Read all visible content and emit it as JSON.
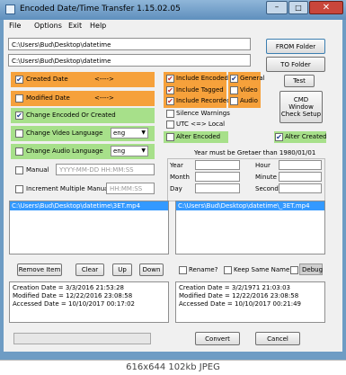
{
  "window": {
    "title": "Encoded Date/Time Transfer 1.15.02.05",
    "minimize": "–",
    "maximize": "□",
    "close": "✕"
  },
  "menu": [
    "File",
    "Options",
    "Exit",
    "Help"
  ],
  "paths": {
    "source": "C:\\Users\\Bud\\Desktop\\datetime",
    "target": "C:\\Users\\Bud\\Desktop\\datetime"
  },
  "buttons": {
    "from_folder": "FROM Folder",
    "to_folder": "TO Folder",
    "test": "Test",
    "cmd_window": "CMD\nWindow\nCheck Setup",
    "remove_item": "Remove Item",
    "clear": "Clear",
    "up": "Up",
    "down": "Down",
    "convert": "Convert",
    "cancel": "Cancel"
  },
  "left_options": {
    "created_date": {
      "label": "Created Date",
      "arrow": "<---->",
      "checked": true
    },
    "modified_date": {
      "label": "Modified Date",
      "arrow": "<---->",
      "checked": false
    },
    "change_encoded": {
      "label": "Change Encoded Or Created",
      "checked": true
    },
    "change_video_lang": {
      "label": "Change Video Language",
      "value": "eng",
      "checked": false
    },
    "change_audio_lang": {
      "label": "Change Audio Language",
      "value": "eng",
      "checked": false
    },
    "manual": {
      "label": "Manual",
      "placeholder": "YYYY-MM-DD HH:MM:SS",
      "checked": false
    },
    "increment": {
      "label": "Increment Multiple Manual",
      "placeholder": "HH:MM:SS",
      "checked": false
    }
  },
  "right_options": {
    "include_encoded": {
      "label": "Include Encoded",
      "checked": true
    },
    "include_tagged": {
      "label": "Include Tagged",
      "checked": true
    },
    "include_recorded": {
      "label": "Include Recorded",
      "checked": true
    },
    "general": {
      "label": "General",
      "checked": true
    },
    "video": {
      "label": "Video",
      "checked": false
    },
    "audio": {
      "label": "Audio",
      "checked": false
    },
    "silence_warnings": {
      "label": "Silence Warnings",
      "checked": false
    },
    "utc_local": {
      "label": "UTC  <=> Local",
      "checked": false
    },
    "alter_encoded": {
      "label": "Alter Encoded",
      "checked": false
    },
    "alter_created": {
      "label": "Alter Created",
      "checked": true
    }
  },
  "year_panel": {
    "heading": "Year must be Gretaer than 1980/01/01",
    "labels": [
      "Year",
      "Month",
      "Day",
      "Hour",
      "Minute",
      "Second"
    ]
  },
  "lists": {
    "source_item": "C:\\Users\\Bud\\Desktop\\datetime\\3ET.mp4",
    "target_item": "C:\\Users\\Bud\\Desktop\\datetime\\_3ET.mp4"
  },
  "bottom_options": {
    "rename": {
      "label": "Rename?",
      "checked": false
    },
    "keep_same_name": {
      "label": "Keep Same Name",
      "checked": false
    },
    "debug": {
      "label": "Debug",
      "checked": false
    }
  },
  "info": {
    "source": "Creation Date = 3/3/2016 21:53:28\nModified Date = 12/22/2016 23:08:58\nAccessed Date = 10/10/2017 00:17:02",
    "target": "Creation Date = 3/2/1971 21:03:03\nModified Date = 12/22/2016 23:08:58\nAccessed Date = 10/10/2017 00:21:49"
  },
  "status_bar": "616x644  102kb  JPEG"
}
